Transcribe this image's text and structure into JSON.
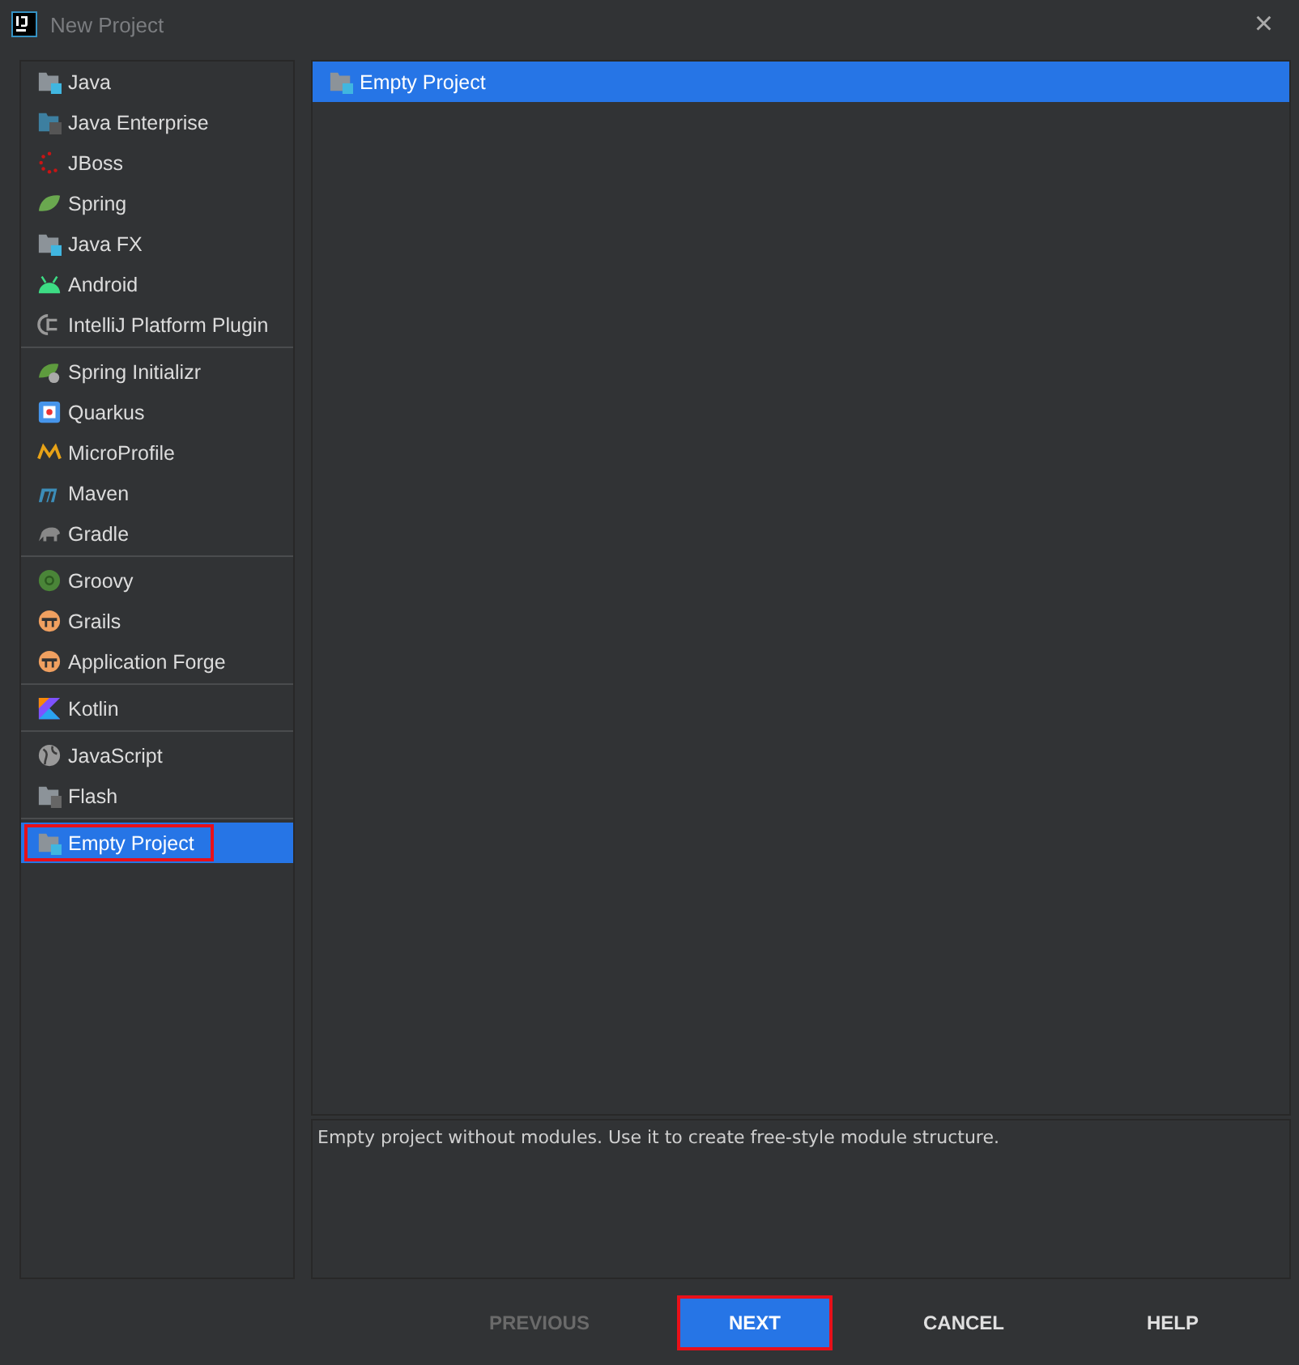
{
  "window": {
    "title": "New Project",
    "close": "×"
  },
  "sidebar": {
    "groups": [
      {
        "items": [
          {
            "kind": "folder",
            "label": "Java",
            "selected": false,
            "highlighted": false
          },
          {
            "kind": "enterprise",
            "label": "Java Enterprise",
            "selected": false,
            "highlighted": false
          },
          {
            "kind": "jboss",
            "label": "JBoss",
            "selected": false,
            "highlighted": false
          },
          {
            "kind": "leaf",
            "label": "Spring",
            "selected": false,
            "highlighted": false
          },
          {
            "kind": "folder",
            "label": "Java FX",
            "selected": false,
            "highlighted": false
          },
          {
            "kind": "android",
            "label": "Android",
            "selected": false,
            "highlighted": false
          },
          {
            "kind": "plug",
            "label": "IntelliJ Platform Plugin",
            "selected": false,
            "highlighted": false
          }
        ]
      },
      {
        "items": [
          {
            "kind": "initializr",
            "label": "Spring Initializr",
            "selected": false,
            "highlighted": false
          },
          {
            "kind": "quarkus",
            "label": "Quarkus",
            "selected": false,
            "highlighted": false
          },
          {
            "kind": "microprofile",
            "label": "MicroProfile",
            "selected": false,
            "highlighted": false
          },
          {
            "kind": "maven",
            "label": "Maven",
            "selected": false,
            "highlighted": false
          },
          {
            "kind": "elephant",
            "label": "Gradle",
            "selected": false,
            "highlighted": false
          }
        ]
      },
      {
        "items": [
          {
            "kind": "groovy",
            "label": "Groovy",
            "selected": false,
            "highlighted": false
          },
          {
            "kind": "grails",
            "label": "Grails",
            "selected": false,
            "highlighted": false
          },
          {
            "kind": "grails",
            "label": "Application Forge",
            "selected": false,
            "highlighted": false
          }
        ]
      },
      {
        "items": [
          {
            "kind": "kotlin",
            "label": "Kotlin",
            "selected": false,
            "highlighted": false
          }
        ]
      },
      {
        "items": [
          {
            "kind": "globe",
            "label": "JavaScript",
            "selected": false,
            "highlighted": false
          },
          {
            "kind": "flash",
            "label": "Flash",
            "selected": false,
            "highlighted": false
          }
        ]
      },
      {
        "items": [
          {
            "kind": "folder",
            "label": "Empty Project",
            "selected": true,
            "highlighted": true
          }
        ]
      }
    ]
  },
  "templates": [
    {
      "label": "Empty Project",
      "selected": true
    }
  ],
  "description": "Empty project without modules. Use it to create free-style module structure.",
  "buttons": [
    {
      "label": "PREVIOUS",
      "disabled": true,
      "default": false,
      "highlighted": false
    },
    {
      "label": "NEXT",
      "disabled": false,
      "default": true,
      "highlighted": true
    },
    {
      "label": "CANCEL",
      "disabled": false,
      "default": false,
      "highlighted": false
    },
    {
      "label": "HELP",
      "disabled": false,
      "default": false,
      "highlighted": false
    }
  ]
}
